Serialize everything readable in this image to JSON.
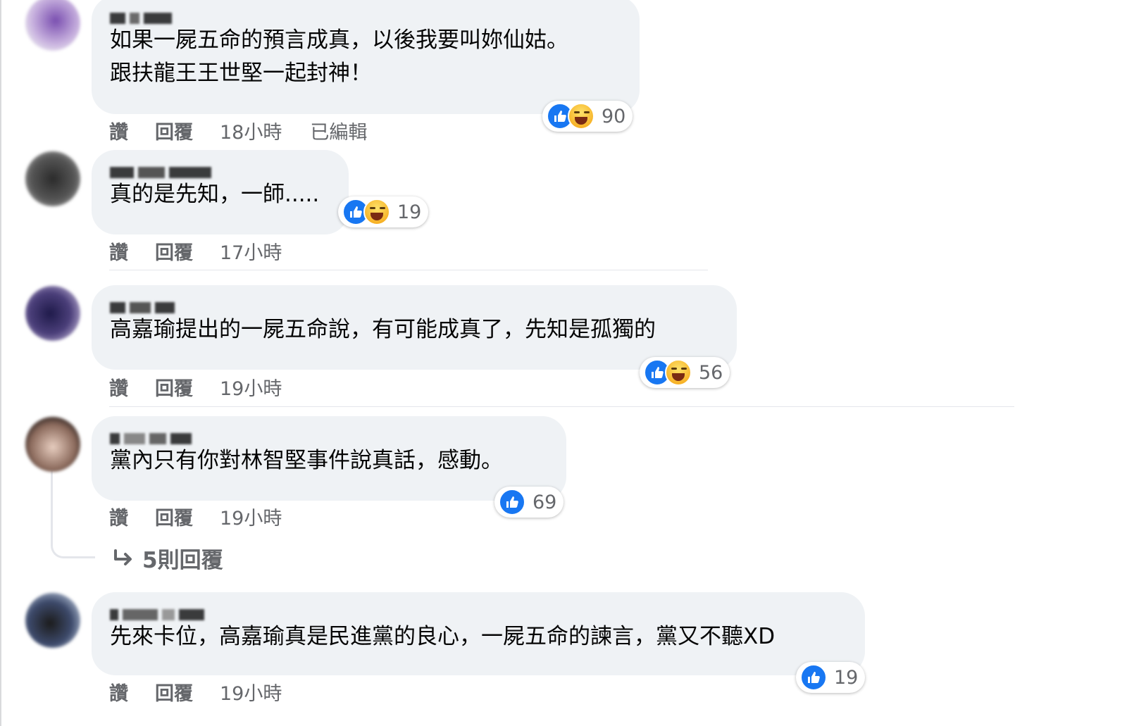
{
  "comments": [
    {
      "text_lines": [
        "如果一屍五命的預言成真，以後我要叫妳仙姑。",
        "跟扶龍王王世堅一起封神！"
      ],
      "reactions": [
        "like-icon",
        "haha-icon"
      ],
      "reaction_count": "90",
      "like_label": "讚",
      "reply_label": "回覆",
      "time": "18小時",
      "edited": "已編輯"
    },
    {
      "text_lines": [
        "真的是先知，一師....."
      ],
      "reactions": [
        "like-icon",
        "haha-icon"
      ],
      "reaction_count": "19",
      "like_label": "讚",
      "reply_label": "回覆",
      "time": "17小時"
    },
    {
      "text_lines": [
        "高嘉瑜提出的一屍五命說，有可能成真了，先知是孤獨的"
      ],
      "reactions": [
        "like-icon",
        "haha-icon"
      ],
      "reaction_count": "56",
      "like_label": "讚",
      "reply_label": "回覆",
      "time": "19小時"
    },
    {
      "text_lines": [
        "黨內只有你對林智堅事件說真話，感動。"
      ],
      "reactions": [
        "like-icon"
      ],
      "reaction_count": "69",
      "like_label": "讚",
      "reply_label": "回覆",
      "time": "19小時",
      "replies_link": "5則回覆"
    },
    {
      "text_lines": [
        "先來卡位，高嘉瑜真是民進黨的良心，一屍五命的諫言，黨又不聽XD"
      ],
      "reactions": [
        "like-icon"
      ],
      "reaction_count": "19",
      "like_label": "讚",
      "reply_label": "回覆",
      "time": "19小時"
    }
  ],
  "colors": {
    "bubble": "#eff2f5",
    "secondary_text": "#65676b",
    "like_blue": "#1877f2",
    "haha_yellow": "#f7b125"
  }
}
